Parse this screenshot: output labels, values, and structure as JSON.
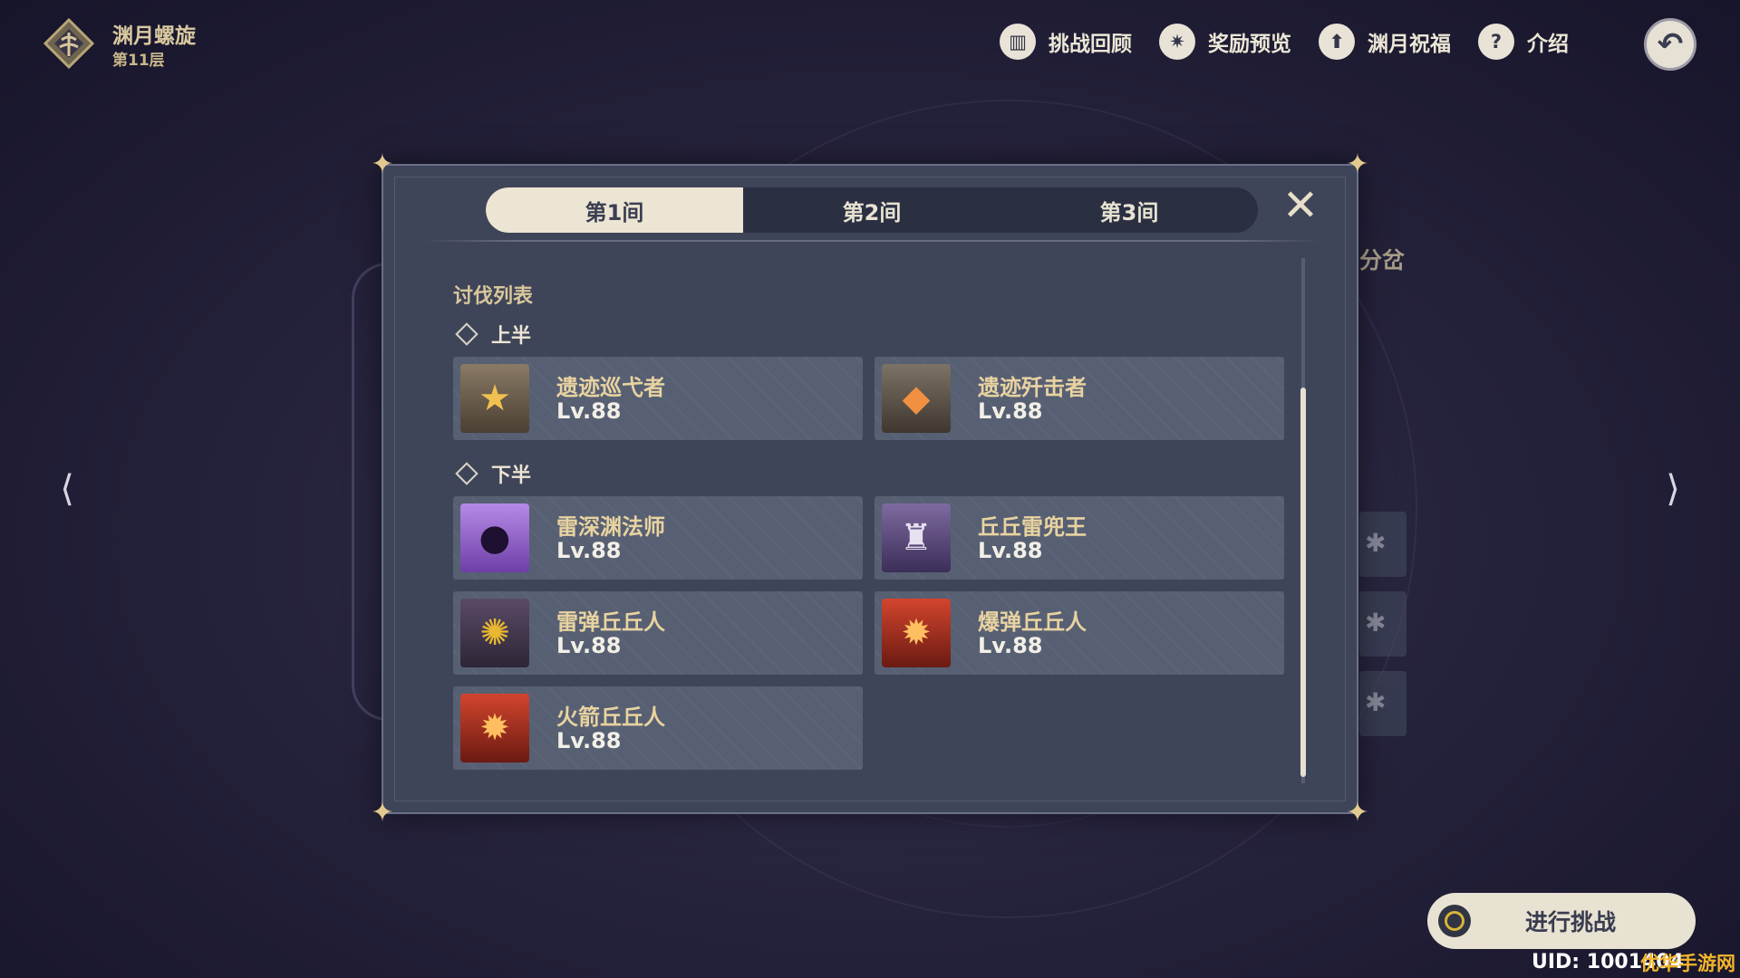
{
  "header": {
    "title": "渊月螺旋",
    "floor": "第11层",
    "logo_icon": "abyss-tree-emblem"
  },
  "topnav": [
    {
      "label": "挑战回顾",
      "icon": "book-icon",
      "glyph": "▥"
    },
    {
      "label": "奖励预览",
      "icon": "star-badge-icon",
      "glyph": "✷"
    },
    {
      "label": "渊月祝福",
      "icon": "up-arrow-icon",
      "glyph": "⬆"
    },
    {
      "label": "介绍",
      "icon": "question-icon",
      "glyph": "?"
    }
  ],
  "back_glyph": "↶",
  "background": {
    "partial_label": "分岔",
    "slot_glyph": "✱"
  },
  "arrows": {
    "left": "⟨",
    "right": "⟩"
  },
  "modal": {
    "tabs": [
      {
        "label": "第1间",
        "active": true
      },
      {
        "label": "第2间",
        "active": false
      },
      {
        "label": "第3间",
        "active": false
      }
    ],
    "close_glyph": "✕",
    "section_title": "讨伐列表",
    "upper_half": {
      "label": "上半",
      "enemies": [
        {
          "name": "遗迹巡弋者",
          "level": "Lv.88",
          "portrait": "ruin-guard"
        },
        {
          "name": "遗迹歼击者",
          "level": "Lv.88",
          "portrait": "ruin-destroyer"
        }
      ]
    },
    "lower_half": {
      "label": "下半",
      "enemies": [
        {
          "name": "雷深渊法师",
          "level": "Lv.88",
          "portrait": "abyss"
        },
        {
          "name": "丘丘雷兜王",
          "level": "Lv.88",
          "portrait": "lawachurl"
        },
        {
          "name": "雷弹丘丘人",
          "level": "Lv.88",
          "portrait": "electro-slime"
        },
        {
          "name": "爆弹丘丘人",
          "level": "Lv.88",
          "portrait": "blazing"
        },
        {
          "name": "火箭丘丘人",
          "level": "Lv.88",
          "portrait": "blazing"
        }
      ]
    }
  },
  "challenge_button": {
    "label": "进行挑战"
  },
  "uid": "UID: 1001404",
  "watermark": "优华手游网",
  "colors": {
    "accent_gold": "#d8c79c",
    "panel": "#3f4558",
    "card": "#545c70"
  }
}
